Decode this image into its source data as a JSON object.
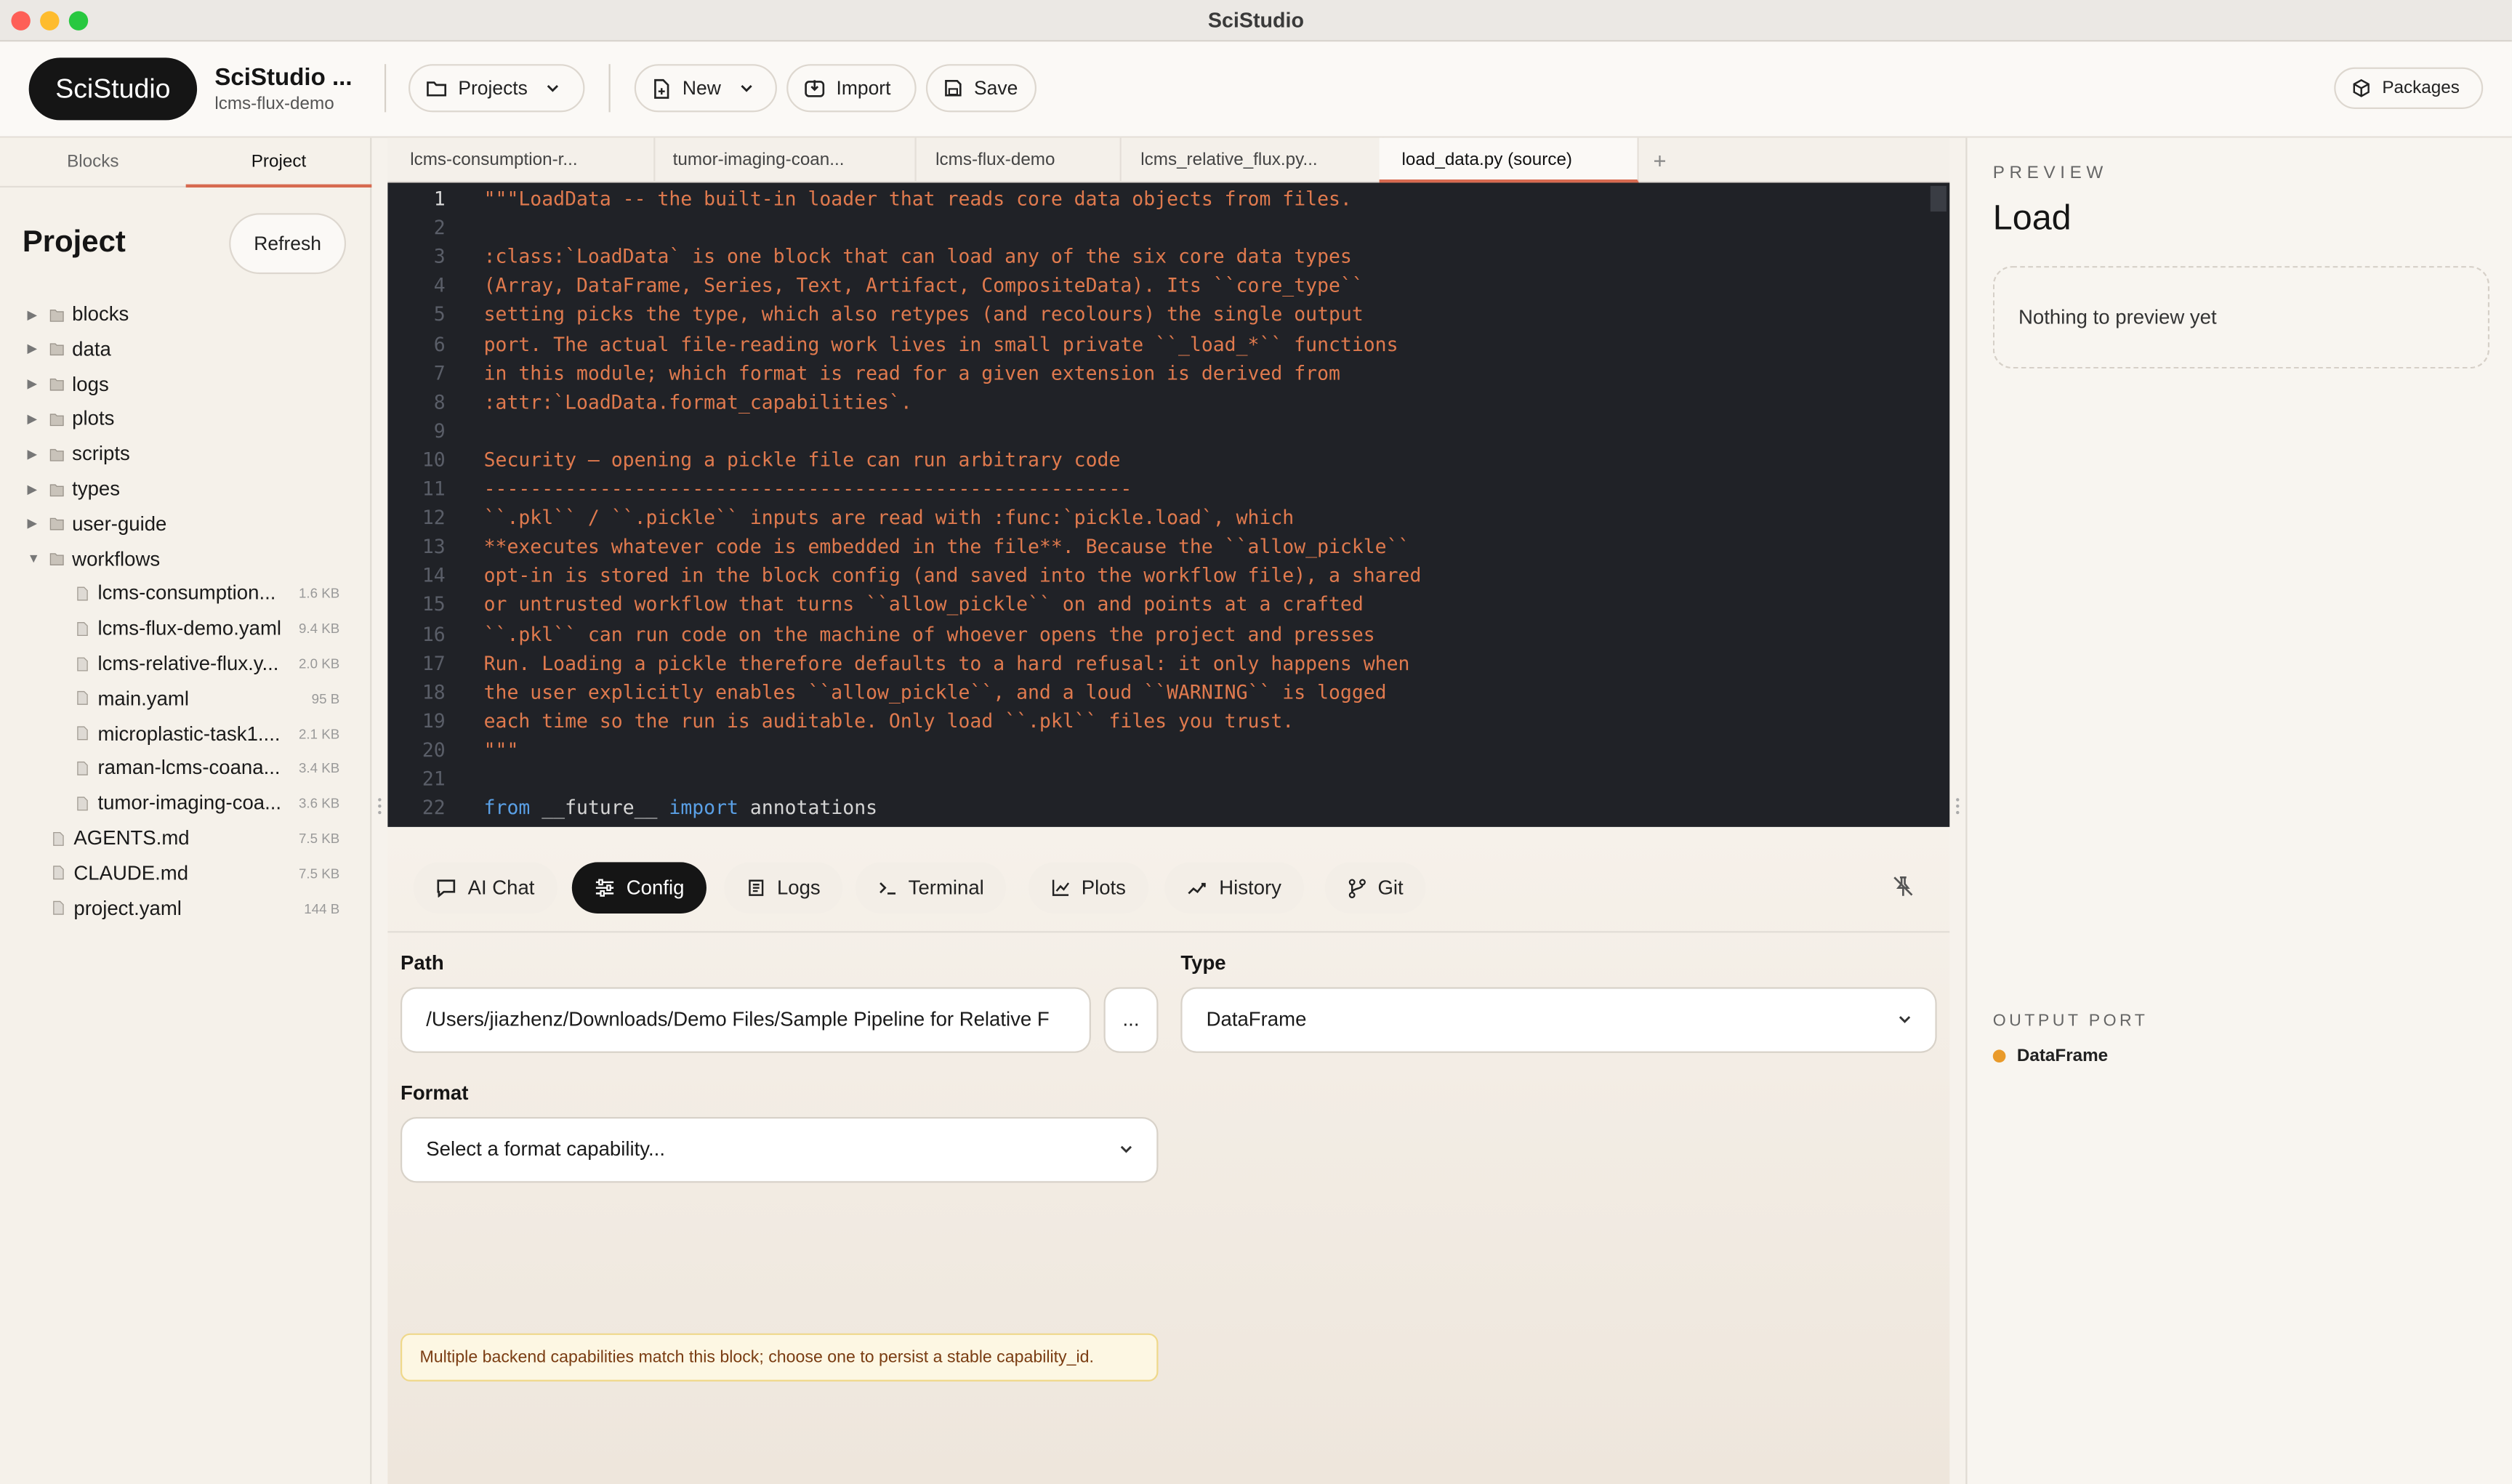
{
  "window": {
    "title": "SciStudio"
  },
  "header": {
    "logo": "SciStudio",
    "app_title": "SciStudio ...",
    "app_subtitle": "lcms-flux-demo",
    "projects_label": "Projects",
    "new_label": "New",
    "import_label": "Import",
    "save_label": "Save",
    "packages_label": "Packages"
  },
  "sidebar": {
    "tabs": [
      {
        "label": "Blocks"
      },
      {
        "label": "Project"
      }
    ],
    "active_tab": "Project",
    "title": "Project",
    "refresh_label": "Refresh",
    "folders": [
      {
        "name": "blocks"
      },
      {
        "name": "data"
      },
      {
        "name": "logs"
      },
      {
        "name": "plots"
      },
      {
        "name": "scripts"
      },
      {
        "name": "types"
      },
      {
        "name": "user-guide"
      },
      {
        "name": "workflows"
      }
    ],
    "workflow_files": [
      {
        "name": "lcms-consumption...",
        "size": "1.6 KB"
      },
      {
        "name": "lcms-flux-demo.yaml",
        "size": "9.4 KB"
      },
      {
        "name": "lcms-relative-flux.y...",
        "size": "2.0 KB"
      },
      {
        "name": "main.yaml",
        "size": "95 B"
      },
      {
        "name": "microplastic-task1....",
        "size": "2.1 KB"
      },
      {
        "name": "raman-lcms-coana...",
        "size": "3.4 KB"
      },
      {
        "name": "tumor-imaging-coa...",
        "size": "3.6 KB"
      }
    ],
    "root_files": [
      {
        "name": "AGENTS.md",
        "size": "7.5 KB"
      },
      {
        "name": "CLAUDE.md",
        "size": "7.5 KB"
      },
      {
        "name": "project.yaml",
        "size": "144 B"
      }
    ]
  },
  "editor": {
    "tabs": [
      {
        "label": "lcms-consumption-r..."
      },
      {
        "label": "tumor-imaging-coan..."
      },
      {
        "label": "lcms-flux-demo"
      },
      {
        "label": "lcms_relative_flux.py..."
      },
      {
        "label": "load_data.py (source)"
      }
    ],
    "active_tab": "load_data.py (source)",
    "add_tab_label": "+",
    "lines": [
      {
        "n": "1",
        "text": "\"\"\"LoadData -- the built-in loader that reads core data objects from files."
      },
      {
        "n": "2",
        "text": ""
      },
      {
        "n": "3",
        "text": ":class:`LoadData` is one block that can load any of the six core data types"
      },
      {
        "n": "4",
        "text": "(Array, DataFrame, Series, Text, Artifact, CompositeData). Its ``core_type``"
      },
      {
        "n": "5",
        "text": "setting picks the type, which also retypes (and recolours) the single output"
      },
      {
        "n": "6",
        "text": "port. The actual file-reading work lives in small private ``_load_*`` functions"
      },
      {
        "n": "7",
        "text": "in this module; which format is read for a given extension is derived from"
      },
      {
        "n": "8",
        "text": ":attr:`LoadData.format_capabilities`."
      },
      {
        "n": "9",
        "text": ""
      },
      {
        "n": "10",
        "text": "Security — opening a pickle file can run arbitrary code"
      },
      {
        "n": "11",
        "text": "--------------------------------------------------------"
      },
      {
        "n": "12",
        "text": "``.pkl`` / ``.pickle`` inputs are read with :func:`pickle.load`, which"
      },
      {
        "n": "13",
        "text": "**executes whatever code is embedded in the file**. Because the ``allow_pickle``"
      },
      {
        "n": "14",
        "text": "opt-in is stored in the block config (and saved into the workflow file), a shared"
      },
      {
        "n": "15",
        "text": "or untrusted workflow that turns ``allow_pickle`` on and points at a crafted"
      },
      {
        "n": "16",
        "text": "``.pkl`` can run code on the machine of whoever opens the project and presses"
      },
      {
        "n": "17",
        "text": "Run. Loading a pickle therefore defaults to a hard refusal: it only happens when"
      },
      {
        "n": "18",
        "text": "the user explicitly enables ``allow_pickle``, and a loud ``WARNING`` is logged"
      },
      {
        "n": "19",
        "text": "each time so the run is auditable. Only load ``.pkl`` files you trust."
      },
      {
        "n": "20",
        "text": "\"\"\""
      },
      {
        "n": "21",
        "text": ""
      }
    ],
    "code_line": {
      "n": "22",
      "kw1": "from",
      "mod": " __future__ ",
      "kw2": "import",
      "rest": " annotations"
    }
  },
  "bottom": {
    "tabs": [
      {
        "label": "AI Chat"
      },
      {
        "label": "Config"
      },
      {
        "label": "Logs"
      },
      {
        "label": "Terminal"
      },
      {
        "label": "Plots"
      },
      {
        "label": "History"
      },
      {
        "label": "Git"
      }
    ],
    "active_tab": "Config",
    "path_label": "Path",
    "path_value": "/Users/jiazhenz/Downloads/Demo Files/Sample Pipeline for Relative F",
    "browse_label": "...",
    "type_label": "Type",
    "type_value": "DataFrame",
    "format_label": "Format",
    "format_placeholder": "Select a format capability...",
    "notice": "Multiple backend capabilities match this block; choose one to persist a stable capability_id."
  },
  "preview": {
    "section_label": "PREVIEW",
    "title": "Load",
    "empty_text": "Nothing to preview yet",
    "output_port_label": "OUTPUT PORT",
    "output_port_value": "DataFrame"
  },
  "colors": {
    "accent": "#d76a50",
    "editor_bg": "#202227",
    "docstring": "#e07a4e",
    "keyword": "#5aa0e6",
    "port_dot": "#e99a2a"
  }
}
